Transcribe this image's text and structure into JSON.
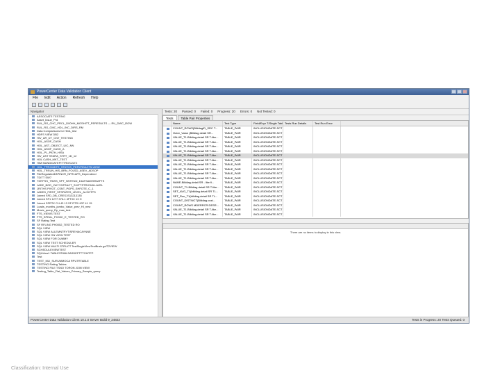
{
  "window": {
    "title": "PowerCenter Data Validation Client"
  },
  "menu": [
    "File",
    "Edit",
    "Action",
    "Refresh",
    "Help"
  ],
  "left_panel": {
    "header": "Navigator",
    "items": [
      "ASSOCIATE TESTING",
      "Asset_Issue_Prd",
      "RUL_RG_CHC_PRCL_D00HH_MOSHITT_PERESULTS — RU_DWC_ROW",
      "RUL_RG_CMC_HDL_INC_DIRS_RM",
      "Data Comparisons for HDA_test",
      "HDFS VIEW DB2",
      "HIV_AR_DT_CNT_TESTING",
      "HOL_ASOF_CASH",
      "HOL_AST_OBJECT_UIC_NN",
      "HOL_ASOF_CASH_A",
      "HOL_PL_PATH_HISA",
      "HIV_AST STARA_STRT_1D_12",
      "HOL CASH_MKT_TEST",
      "HIM MANDIDATEPITTRDSULT2",
      "HOL_TPRCMDTE_STATHS_PERYRDACT5-VIEW",
      "HOL_TRSUN_HIS_BRN_FOLSD_ASEV_ADSOP",
      "FileRegulated1BPINCR_NFR1APS_Dependend",
      "TDITT SW7",
      "TMTFSS_TSWS_SPT_NSTEND_15ATSAMHENAFTS",
      "JADE_BOD_JWYYNTRACT_SHITTSTRICMILLAVEL",
      "JRITHS PIVOT_CSNT_POPS_SHFOTE_C_1",
      "JADED_FIRST_SFSPATES_LEVEL_ALSOTPS",
      "Joined SFD_DB_CRES1S13213135",
      "Joined SF1 1277 376-1 4FT/IC 13 H",
      "Joined SFRTK CH 43 13 SF RTS HSF 41 15",
      "Loads_months_jumbo_Value_prev_HI_new",
      "Movie_query_Ep_max_test",
      "FTS_VIEWS TEST",
      "FTS_SPEAL_PH03C_E_TESTED_RO",
      "SF Rating Test",
      "SF RFLING PH0052_TESTED RO",
      "SQL VIEW",
      "SQL VIEW ALLEMNTRYTISREHACAYNNE",
      "SQL VIEW ON VIEW TEST",
      "SQL VIEW FOR DUMMY",
      "SQL VIEW TEST SCHEDULER",
      "SQL VIEW MULTI STRUCT TestSingleViewTestBrain.gcfT2VIEW",
      "SCHEDULEVIEWTEST",
      "SQLView1 TABLESTABLSASDEFTTTCMTFP",
      "Test",
      "TEST_MLI_SURUMMOCA RPUTRTABLE",
      "TESTING Rating Tables",
      "TESTING FILE TSNO TORON JOIN VIEW",
      "Testing_Table_Flat_Values_Primary_Sample_query"
    ],
    "selected_index": 14
  },
  "summary": [
    "Tests: 20",
    "Passed: 0",
    "Failed: 0",
    "Progress: 20",
    "Errors: 0",
    "Not Tested: 0"
  ],
  "tabs": [
    "Tests",
    "Table Pair Properties"
  ],
  "grid": {
    "columns": [
      "",
      "Name",
      "Test Type",
      "Field/Expr T/Single Table",
      "Tests Run Details",
      "Test Run Error"
    ],
    "rows": [
      [
        "COUNT_ROWS(BilldiagID_SRC T...",
        "TABLE_PAIR",
        "INCLUSIONDATE-SCT IC ..."
      ],
      [
        "Outer_Value (Billdiag detail SR...",
        "TABLE_PAIR",
        "INCLUSIONDATE-SCT IC ..."
      ],
      [
        "VALUE_T1-Billdiag-detail SR T-like...",
        "TABLE_PAIR",
        "INCLUSIONDATE-SCT IC ..."
      ],
      [
        "VALUE_T1-Billdiag-detail SR T-like...",
        "TABLE_PAIR",
        "INCLUSIONDATE-SCT IC ..."
      ],
      [
        "VALUE_T1-Billdiag-detail SR T-like...",
        "TABLE_PAIR",
        "INCLUSIONDATE-SCT IC ..."
      ],
      [
        "VALUE_T1-Billdiag-detail SR T-like...",
        "TABLE_PAIR",
        "INCLUSIONDATE-SCT IC ..."
      ],
      [
        "VALUE_T1-Billdiag-detail SR T-like...",
        "TABLE_PAIR",
        "INCLUSIONDATE-SCT IC ..."
      ],
      [
        "VALUE_T1-Billdiag-detail SR T-like...",
        "TABLE_PAIR",
        "INCLUSIONDATE-SCT IC ..."
      ],
      [
        "VALUE_T1-Billdiag-detail SR T-like...",
        "TABLE_PAIR",
        "INCLUSIONDATE-SCT IC ..."
      ],
      [
        "VALUE_T1-Billdiag-detail SR T-like...",
        "TABLE_PAIR",
        "INCLUSIONDATE-SCT IC ..."
      ],
      [
        "VALUE_T1-Billdiag-detail SR T-like...",
        "TABLE_PAIR",
        "INCLUSIONDATE-SCT IC ..."
      ],
      [
        "VALUE_T1-Billdiag-detail SR T-like...",
        "TABLE_PAIR",
        "INCLUSIONDATE-SCT IC ..."
      ],
      [
        "NAME-Billdiag-detail SR - like fi...",
        "TABLE_PAIR",
        "INCLUSIONDATE-SCT IC ..."
      ],
      [
        "COUNT_T1-Billdiag detail SR T-like...",
        "TABLE_PAIR",
        "INCLUSIONDATE-SCT IC ..."
      ],
      [
        "SET_AVG_T1(billdiag.detail SR TL...",
        "TABLE_PAIR",
        "INCLUSIONDATE-SCT IC ..."
      ],
      [
        "SET_Run_T1(billdiag.detail SR TL...",
        "TABLE_PAIR",
        "INCLUSIONDATE-SCT IC ..."
      ],
      [
        "COUNT_DISTINCT(Billdiag.cust...",
        "TABLE_PAIR",
        "INCLUSIONDATE-SCT IC ..."
      ],
      [
        "COUNT_ROWS MDERRCR.DESR...",
        "TABLE_PAIR",
        "INCLUSIONDATE-SCT IC ..."
      ],
      [
        "VALUE_T1-Billdiag-detail SR T-like...",
        "TABLE_PAIR",
        "INCLUSIONDATE-SCT IC ..."
      ],
      [
        "VALUE_T1-Billdiag-detail SR T-like...",
        "TABLE_PAIR",
        "INCLUSIONDATE-SCT IC ..."
      ]
    ],
    "highlight_index": 6
  },
  "lower_panel": {
    "message": "There are no items to display in this view."
  },
  "status": {
    "left": "PowerCenter Data Validation Client 10.1.0 Server Build 9_24823",
    "right": "Tests in Progress: 20   Tests Queued: 0"
  },
  "footer": "Classification: Internal Use"
}
